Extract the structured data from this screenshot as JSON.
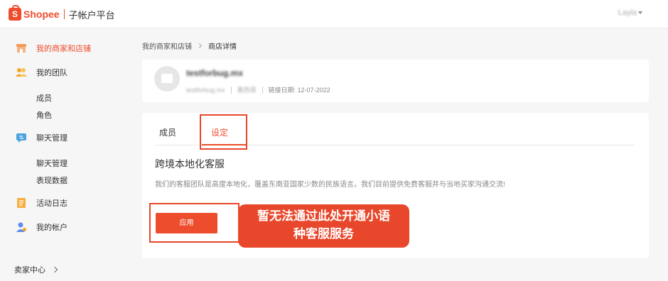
{
  "header": {
    "brand": "Shopee",
    "subtitle": "子帐户平台",
    "user": "Layla"
  },
  "sidebar": {
    "items": [
      {
        "label": "我的商家和店铺",
        "active": true,
        "icon": "store-icon"
      },
      {
        "label": "我的团队",
        "active": false,
        "icon": "team-icon"
      },
      {
        "label": "聊天管理",
        "active": false,
        "icon": "chat-icon"
      },
      {
        "label": "活动日志",
        "active": false,
        "icon": "log-icon"
      },
      {
        "label": "我的帐户",
        "active": false,
        "icon": "account-icon"
      }
    ],
    "team_sub": [
      "成员",
      "角色"
    ],
    "chat_sub": [
      "聊天管理",
      "表现数据"
    ],
    "seller_center": "卖家中心"
  },
  "breadcrumb": {
    "parent": "我的商家和店铺",
    "current": "商店详情"
  },
  "shop": {
    "name": "testforbug.mx",
    "username": "testforbug.mx",
    "region": "墨西哥",
    "linked_date": "链接日期: 12-07-2022"
  },
  "tabs": [
    {
      "label": "成员",
      "active": false
    },
    {
      "label": "设定",
      "active": true
    }
  ],
  "section": {
    "title": "跨境本地化客服",
    "description": "我们的客服团队是高度本地化，覆盖东南亚国家少数的民族语言。我们目前提供免费客服并与当地买家沟通交流!"
  },
  "apply_button": "应用",
  "callout": {
    "line1": "暂无法通过此处开通小语",
    "line2": "种客服服务"
  },
  "colors": {
    "accent": "#ee4d2d",
    "highlight": "#e8462a"
  }
}
